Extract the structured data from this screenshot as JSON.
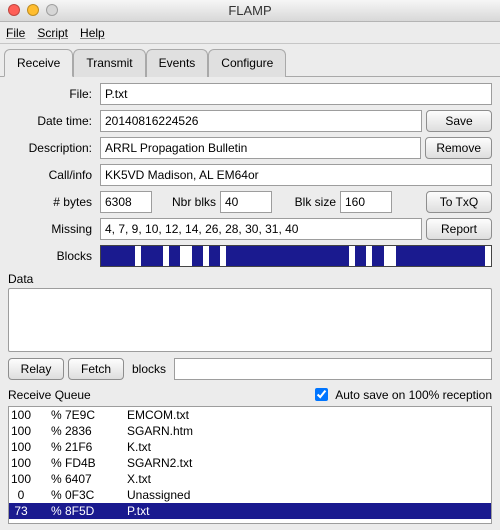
{
  "window": {
    "title": "FLAMP"
  },
  "menu": {
    "file": "File",
    "script": "Script",
    "help": "Help"
  },
  "tabs": {
    "receive": "Receive",
    "transmit": "Transmit",
    "events": "Events",
    "configure": "Configure"
  },
  "labels": {
    "file": "File:",
    "datetime": "Date time:",
    "description": "Description:",
    "callinfo": "Call/info",
    "bytes": "# bytes",
    "nbrblks": "Nbr blks",
    "blksize": "Blk size",
    "missing": "Missing",
    "blocks": "Blocks",
    "data": "Data",
    "blocks_small": "blocks",
    "receive_queue": "Receive Queue"
  },
  "fields": {
    "file": "P.txt",
    "datetime": "20140816224526",
    "description": "ARRL Propagation Bulletin",
    "callinfo": "KK5VD Madison, AL EM64or",
    "bytes": "6308",
    "nbrblks": "40",
    "blksize": "160",
    "missing": "4, 7, 9, 10, 12, 14, 26, 28, 30, 31, 40"
  },
  "buttons": {
    "save": "Save",
    "remove": "Remove",
    "to_txq": "To TxQ",
    "report": "Report",
    "relay": "Relay",
    "fetch": "Fetch"
  },
  "autosave": {
    "label": "Auto save on 100% reception",
    "checked": true
  },
  "queue": [
    {
      "pct": "100",
      "sym": "%",
      "id": "7E9C",
      "name": "EMCOM.txt",
      "selected": false
    },
    {
      "pct": "100",
      "sym": "%",
      "id": "2836",
      "name": "SGARN.htm",
      "selected": false
    },
    {
      "pct": "100",
      "sym": "%",
      "id": "21F6",
      "name": "K.txt",
      "selected": false
    },
    {
      "pct": "100",
      "sym": "%",
      "id": "FD4B",
      "name": "SGARN2.txt",
      "selected": false
    },
    {
      "pct": "100",
      "sym": "%",
      "id": "6407",
      "name": "X.txt",
      "selected": false
    },
    {
      "pct": "0",
      "sym": "%",
      "id": "0F3C",
      "name": "Unassigned",
      "selected": false
    },
    {
      "pct": "73",
      "sym": "%",
      "id": "8F5D",
      "name": "P.txt",
      "selected": true
    }
  ],
  "blocks_missing_idx": [
    4,
    7,
    9,
    10,
    12,
    14,
    26,
    28,
    30,
    31,
    40
  ],
  "blocks_total": 40
}
